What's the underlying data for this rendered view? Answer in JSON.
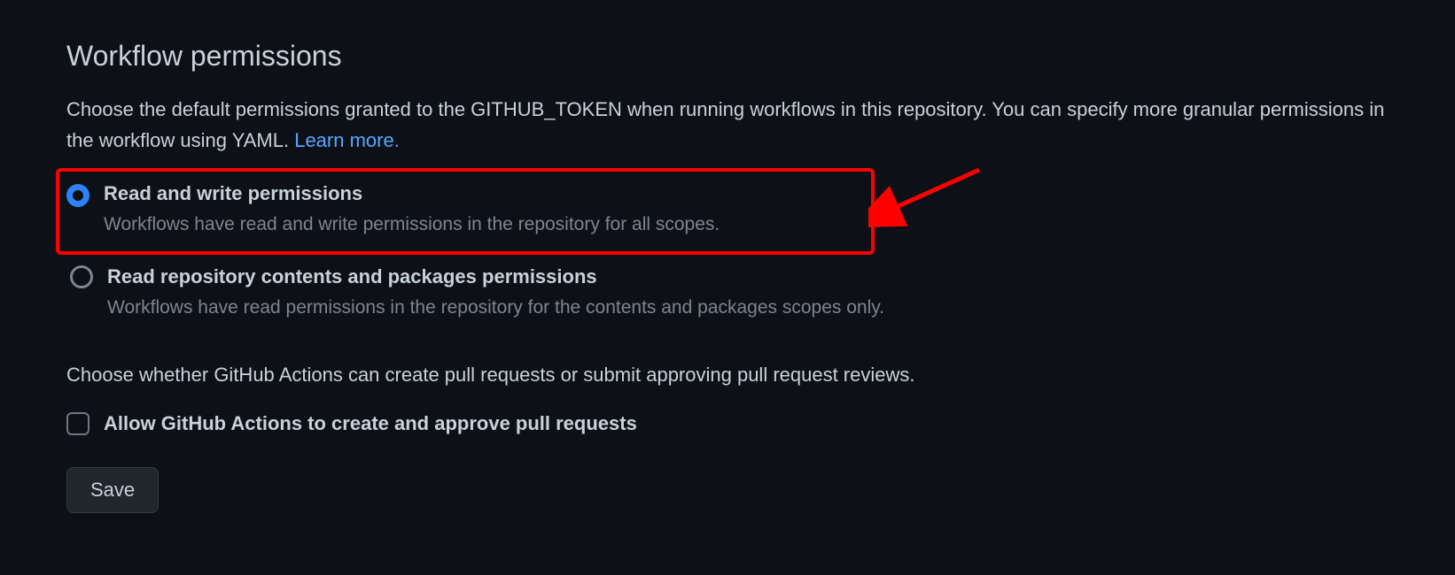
{
  "section": {
    "title": "Workflow permissions",
    "description_prefix": "Choose the default permissions granted to the GITHUB_TOKEN when running workflows in this repository. You can specify more granular permissions in the workflow using YAML. ",
    "learn_more_text": "Learn more."
  },
  "options": {
    "read_write": {
      "label": "Read and write permissions",
      "description": "Workflows have read and write permissions in the repository for all scopes.",
      "selected": true
    },
    "read_only": {
      "label": "Read repository contents and packages permissions",
      "description": "Workflows have read permissions in the repository for the contents and packages scopes only.",
      "selected": false
    }
  },
  "pr_section": {
    "description": "Choose whether GitHub Actions can create pull requests or submit approving pull request reviews.",
    "checkbox_label": "Allow GitHub Actions to create and approve pull requests",
    "checked": false
  },
  "buttons": {
    "save": "Save"
  },
  "colors": {
    "background": "#0d1117",
    "text_primary": "#c9d1d9",
    "text_secondary": "#7d8590",
    "link": "#58a6ff",
    "accent": "#2f81f7",
    "highlight": "#ff0000"
  }
}
